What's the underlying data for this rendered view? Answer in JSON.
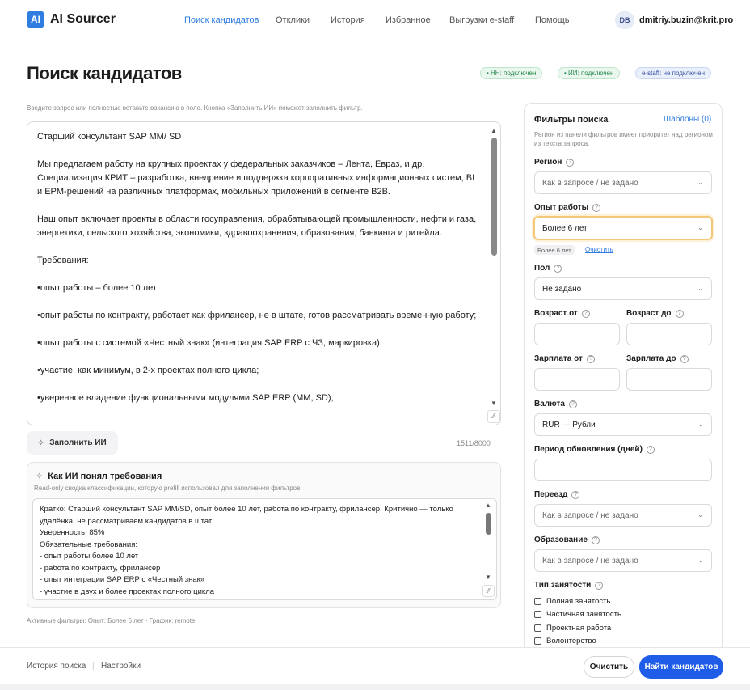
{
  "app": {
    "logo_mark": "AI",
    "name": "AI Sourcer"
  },
  "nav": {
    "items": [
      {
        "label": "Поиск кандидатов",
        "active": true
      },
      {
        "label": "Отклики"
      },
      {
        "label": "История"
      },
      {
        "label": "Избранное"
      },
      {
        "label": "Выгрузки e-staff"
      },
      {
        "label": "Помощь"
      }
    ],
    "user_initials": "DB",
    "user_email": "dmitriy.buzin@krit.pro"
  },
  "page": {
    "title": "Поиск кандидатов",
    "status": [
      "• HH: подключен",
      "• ИИ: подключен",
      "e-staff: не подключен"
    ],
    "hint": "Введите запрос или полностью вставьте вакансию в поле. Кнопка «Заполнить ИИ» поможет заполнить фильтр."
  },
  "query": {
    "paragraphs": [
      "Старший консультант SAP MM/ SD",
      "Мы предлагаем работу на крупных проектах у федеральных заказчиков – Лента, Евраз, и др. Специализация КРИТ – разработка, внедрение и поддержка корпоративных информационных систем, BI и EPM-решений на различных платформах, мобильных приложений в сегменте B2B.",
      "Наш опыт включает проекты в области госуправления, обрабатывающей промышленности, нефти и газа, энергетики, сельского хозяйства, экономики, здравоохранения, образования, банкинга и ритейла.",
      "Требования:",
      "•опыт работы – более 10 лет;",
      "•опыт работы по контракту, работает как фрилансер, не в штате, готов рассматривать временную работу;",
      "•опыт работы с системой «Честный знак» (интеграция SAP ERP с ЧЗ, маркировка);",
      "•участие, как минимум, в 2-х проектах полного цикла;",
      "•уверенное владение функциональными модулями SAP ERP (MM, SD);"
    ],
    "fill_button": "Заполнить ИИ",
    "char_count": "1511/8000"
  },
  "ai_summary": {
    "title": "Как ИИ понял требования",
    "subtitle": "Read-only сводка классификации, которую prefill использовал для заполнения фильтров.",
    "text": "Кратко: Старший консультант SAP MM/SD, опыт более 10 лет, работа по контракту, фрилансер. Критично — только удалёнка, не рассматриваем кандидатов в штат.\nУверенность: 85%\nОбязательные требования:\n- опыт работы более 10 лет\n- работа по контракту, фрилансер\n- опыт интеграции SAP ERP с «Честный знак»\n- участие в двух и более проектах полного цикла\n- уверенное владение модулями MM и SD SAP ERP"
  },
  "active_filters": "Активные фильтры: Опыт: Более 6 лет · График: remote",
  "filters": {
    "title": "Фильтры поиска",
    "templates": "Шаблоны (0)",
    "hint": "Регион из панели фильтров имеет приоритет над регионом из текста запроса.",
    "region": {
      "label": "Регион",
      "value": "Как в запросе / не задано"
    },
    "experience": {
      "label": "Опыт работы",
      "value": "Более 6 лет",
      "chip": "Более 6 лет",
      "clear": "Очистить"
    },
    "gender": {
      "label": "Пол",
      "value": "Не задано"
    },
    "age_from": "Возраст от",
    "age_to": "Возраст до",
    "salary_from": "Зарплата от",
    "salary_to": "Зарплата до",
    "currency": {
      "label": "Валюта",
      "value": "RUR — Рубли"
    },
    "refresh_period": "Период обновления (дней)",
    "relocation": {
      "label": "Переезд",
      "value": "Как в запросе / не задано"
    },
    "education": {
      "label": "Образование",
      "value": "Как в запросе / не задано"
    },
    "employment": {
      "label": "Тип занятости",
      "options": [
        "Полная занятость",
        "Частичная занятость",
        "Проектная работа",
        "Волонтерство"
      ]
    },
    "help_glyph": "?",
    "chevron": "⌄"
  },
  "bottom": {
    "history": "История поиска",
    "separator": "|",
    "settings": "Настройки",
    "clear_button": "Очистить",
    "find_button": "Найти кандидатов"
  },
  "glyphs": {
    "sparkle": "✧",
    "scroll_up": "▲",
    "scroll_down": "▼",
    "resize": "⁄⁄"
  },
  "colors": {
    "accent": "#2f7de1",
    "primary_button": "#1f5ce8",
    "status_ok": "#26854a",
    "focus": "#f3c879"
  }
}
